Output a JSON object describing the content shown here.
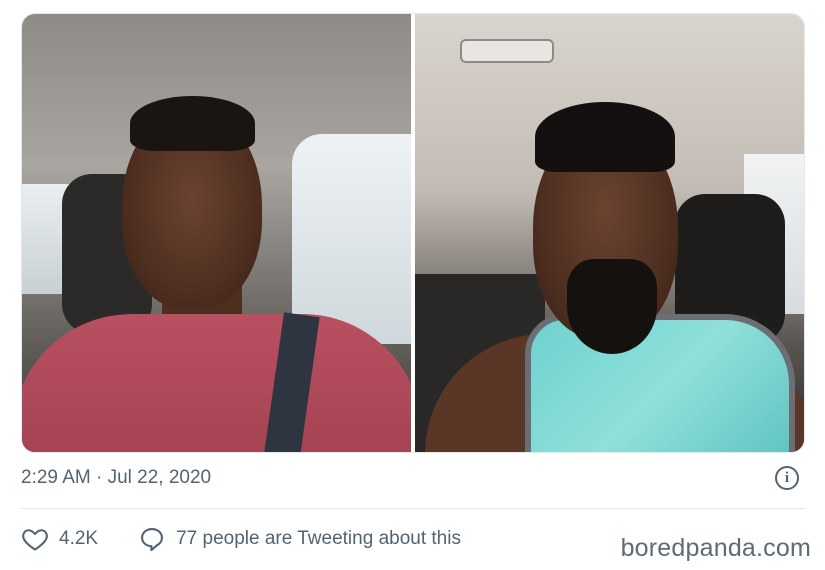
{
  "tweet": {
    "timestamp": "2:29 AM · Jul 22, 2020",
    "likes_count": "4.2K",
    "conversation_text": "77 people are Tweeting about this",
    "icons": {
      "like": "heart-icon",
      "conversation": "speech-bubble-icon",
      "info": "info-icon"
    },
    "info_glyph": "i"
  },
  "watermark": "boredpanda.com",
  "colors": {
    "meta_text": "#536471",
    "divider": "#e1e8ed"
  }
}
